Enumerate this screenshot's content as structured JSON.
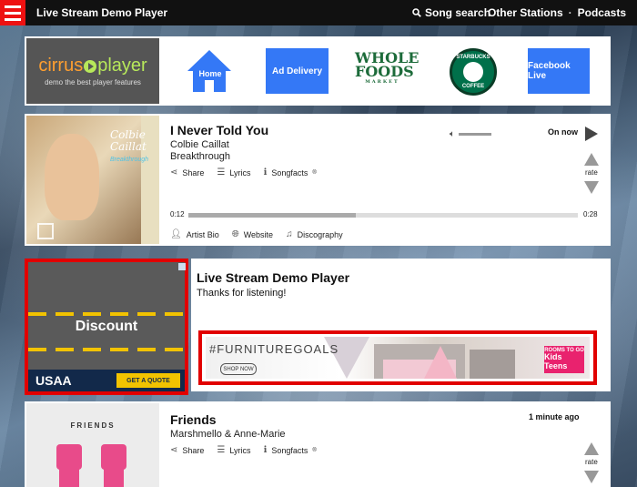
{
  "app": {
    "title": "Live Stream Demo Player"
  },
  "topnav": {
    "search_label": "Song search",
    "other_stations": "Other Stations",
    "separator": "·",
    "podcasts": "Podcasts"
  },
  "banner": {
    "cirrus_part1": "cirrus",
    "cirrus_part2": "player",
    "cirrus_tagline": "demo the best player features",
    "home_label": "Home",
    "ad_delivery_label": "Ad Delivery",
    "wholefoods_line1": "WHOLE",
    "wholefoods_line2": "FOODS",
    "wholefoods_line3": "MARKET",
    "starbucks_top": "STARBUCKS",
    "starbucks_bottom": "COFFEE",
    "facebook_live_label": "Facebook Live"
  },
  "now_playing": {
    "album_artist_script": "Colbie Caillat",
    "album_title_script": "Breakthrough",
    "title": "I Never Told You",
    "artist": "Colbie Caillat",
    "album": "Breakthrough",
    "share": "Share",
    "lyrics": "Lyrics",
    "songfacts": "Songfacts",
    "songfacts_reg": "®",
    "status": "On now",
    "rate": "rate",
    "elapsed": "0:12",
    "duration": "0:28",
    "progress_fraction": 0.43,
    "artist_bio": "Artist Bio",
    "website": "Website",
    "discography": "Discography"
  },
  "ads": {
    "discount": "Discount",
    "usaa": "USAA",
    "get_quote": "GET A QUOTE",
    "furniture_tag": "#FURNITUREGOALS",
    "shop_now": "SHOP NOW",
    "r2g_line1": "ROOMS TO GO",
    "r2g_line2": "Kids",
    "r2g_line3": "Teens"
  },
  "station": {
    "title": "Live Stream Demo Player",
    "message": "Thanks for listening!"
  },
  "recent": {
    "art_label": "FRIENDS",
    "title": "Friends",
    "artist": "Marshmello & Anne-Marie",
    "time": "1 minute ago",
    "share": "Share",
    "lyrics": "Lyrics",
    "songfacts": "Songfacts",
    "songfacts_reg": "®",
    "rate": "rate"
  },
  "colors": {
    "accent_red": "#e11111",
    "blue_button": "#3478f6",
    "topbar": "#111111"
  }
}
